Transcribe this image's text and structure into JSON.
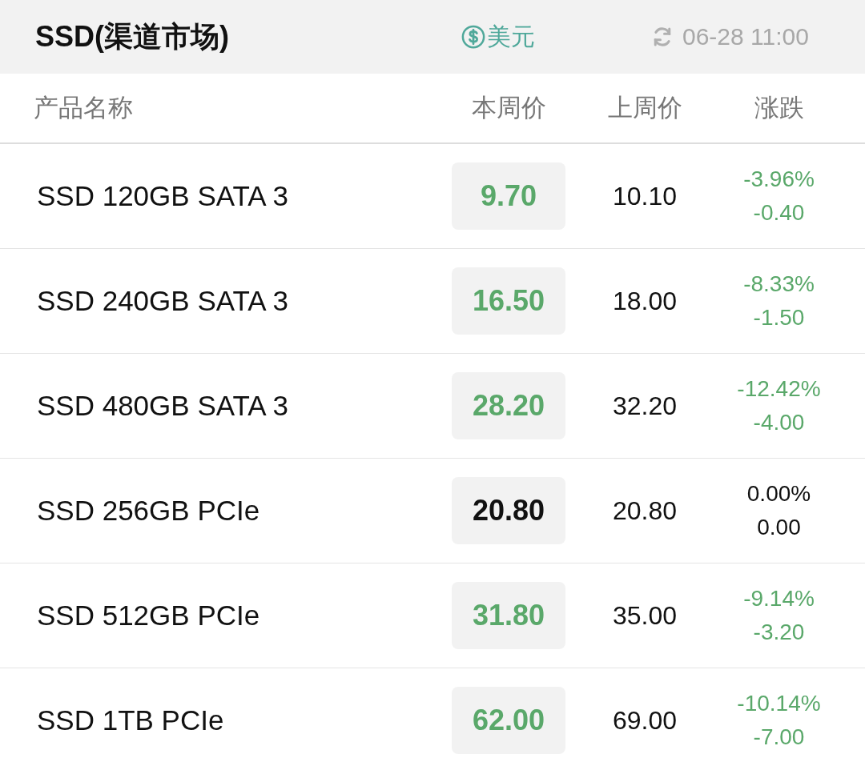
{
  "header": {
    "title": "SSD(渠道市场)",
    "currency": "美元",
    "updated": "06-28 11:00"
  },
  "columns": [
    "产品名称",
    "本周价",
    "上周价",
    "涨跌"
  ],
  "rows": [
    {
      "name": "SSD 120GB SATA 3",
      "price": "9.70",
      "last": "10.10",
      "pct": "-3.96%",
      "diff": "-0.40",
      "color": "#5aa86a"
    },
    {
      "name": "SSD 240GB SATA 3",
      "price": "16.50",
      "last": "18.00",
      "pct": "-8.33%",
      "diff": "-1.50",
      "color": "#5aa86a"
    },
    {
      "name": "SSD 480GB SATA 3",
      "price": "28.20",
      "last": "32.20",
      "pct": "-12.42%",
      "diff": "-4.00",
      "color": "#5aa86a"
    },
    {
      "name": "SSD 256GB PCIe",
      "price": "20.80",
      "last": "20.80",
      "pct": "0.00%",
      "diff": "0.00",
      "color": "#111111"
    },
    {
      "name": "SSD 512GB PCIe",
      "price": "31.80",
      "last": "35.00",
      "pct": "-9.14%",
      "diff": "-3.20",
      "color": "#5aa86a"
    },
    {
      "name": "SSD 1TB PCIe",
      "price": "62.00",
      "last": "69.00",
      "pct": "-10.14%",
      "diff": "-7.00",
      "color": "#5aa86a"
    }
  ]
}
